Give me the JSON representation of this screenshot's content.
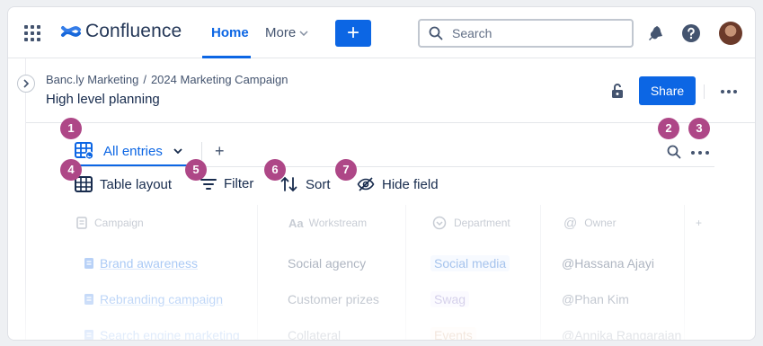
{
  "nav": {
    "brand": "Confluence",
    "home": "Home",
    "more": "More",
    "create": "+",
    "search_placeholder": "Search"
  },
  "page": {
    "breadcrumb": [
      "Banc.ly Marketing",
      "2024 Marketing Campaign"
    ],
    "breadcrumb_sep": "/",
    "title": "High level planning",
    "share": "Share"
  },
  "database": {
    "view_tab": "All entries",
    "add_view": "+",
    "tools": {
      "layout": "Table layout",
      "filter": "Filter",
      "sort": "Sort",
      "hide": "Hide field"
    },
    "columns": [
      "Campaign",
      "Workstream",
      "Department",
      "Owner"
    ],
    "add_column": "+",
    "rows": [
      {
        "campaign": "Brand awareness",
        "workstream": "Social agency",
        "department": "Social media",
        "dept_color": "#e9f2ff",
        "dept_text": "#0055cc",
        "owner": "Hassana Ajayi"
      },
      {
        "campaign": "Rebranding campaign",
        "workstream": "Customer prizes",
        "department": "Swag",
        "dept_color": "#f3f0ff",
        "dept_text": "#5e4db2",
        "owner": "Phan Kim"
      },
      {
        "campaign": "Search engine marketing",
        "workstream": "Collateral",
        "department": "Events",
        "dept_color": "#fff3eb",
        "dept_text": "#a54800",
        "owner": "Annika Rangarajan"
      }
    ],
    "owner_prefix": "@"
  },
  "badges": [
    "1",
    "2",
    "3",
    "4",
    "5",
    "6",
    "7"
  ],
  "colors": {
    "accent": "#0c66e4",
    "badge": "#ae4787"
  }
}
